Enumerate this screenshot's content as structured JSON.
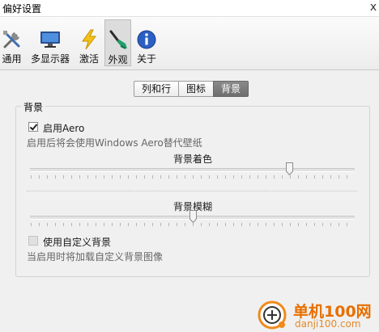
{
  "window": {
    "title": "偏好设置",
    "close_glyph": "x"
  },
  "toolbar": {
    "items": [
      {
        "label": "通用",
        "icon": "tools-icon"
      },
      {
        "label": "多显示器",
        "icon": "monitor-icon"
      },
      {
        "label": "激活",
        "icon": "lightning-icon"
      },
      {
        "label": "外观",
        "icon": "paintbrush-icon",
        "active": true
      },
      {
        "label": "关于",
        "icon": "info-icon"
      }
    ]
  },
  "subtabs": {
    "items": [
      "列和行",
      "图标",
      "背景"
    ],
    "active": "背景"
  },
  "background_group": {
    "title": "背景",
    "aero_checkbox": {
      "label": "启用Aero",
      "checked": true
    },
    "aero_hint": "启用后将会使用Windows Aero替代壁纸",
    "color_slider": {
      "label": "背景着色",
      "value_fraction": 0.8
    },
    "blur_slider": {
      "label": "背景模糊",
      "value_fraction": 0.5
    },
    "custom_bg_checkbox": {
      "label": "使用自定义背景",
      "checked": false,
      "enabled": false
    },
    "custom_bg_hint": "当启用时将加载自定义背景图像"
  },
  "watermark": {
    "name": "单机100网",
    "url": "danji100.com"
  },
  "colors": {
    "active_tab": "#7a7a7a",
    "watermark_orange": "#e76f00"
  }
}
